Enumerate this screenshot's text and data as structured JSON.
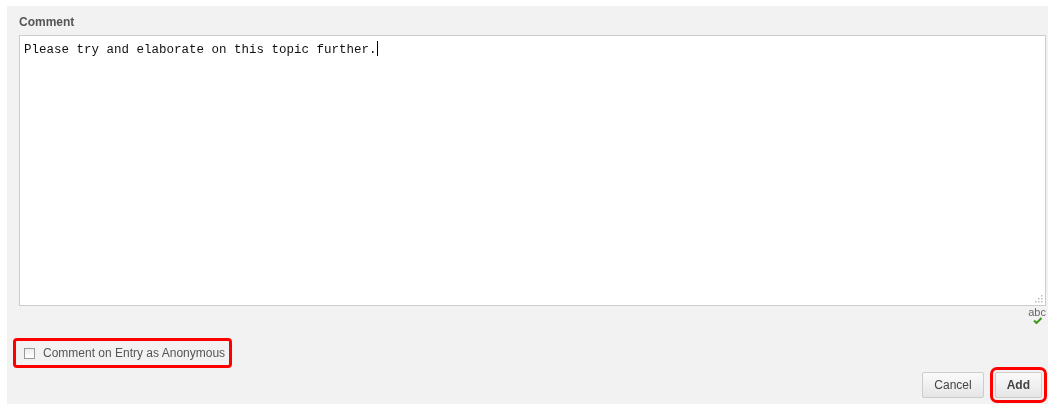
{
  "comment_label": "Comment",
  "comment_field": {
    "value": "Please try and elaborate on this topic further."
  },
  "spellcheck": {
    "label": "abc"
  },
  "anonymous_option": {
    "label": "Comment on Entry as Anonymous",
    "checked": false,
    "highlighted": true
  },
  "buttons": [
    {
      "label": "Cancel",
      "highlighted": false
    },
    {
      "label": "Add",
      "highlighted": true
    }
  ]
}
